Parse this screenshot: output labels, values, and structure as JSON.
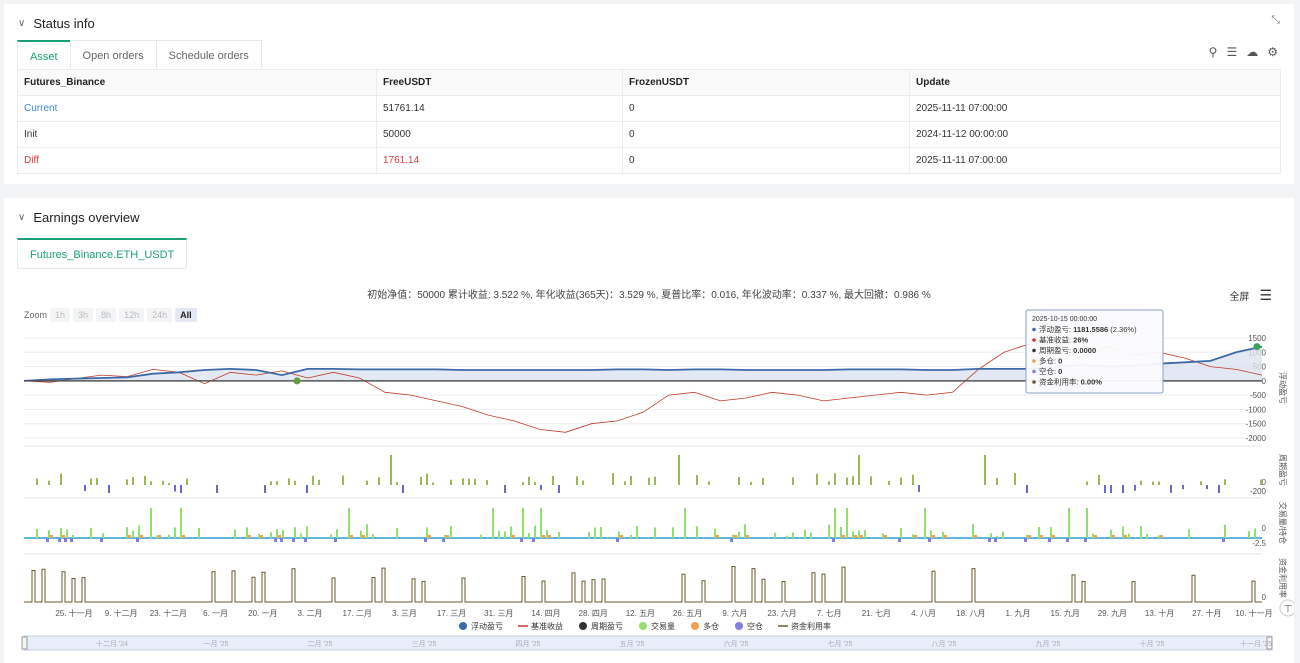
{
  "status": {
    "title": "Status info",
    "tabs": [
      "Asset",
      "Open orders",
      "Schedule orders"
    ],
    "table": {
      "headers": [
        "Futures_Binance",
        "FreeUSDT",
        "FrozenUSDT",
        "Update"
      ],
      "rows": [
        {
          "label": "Current",
          "free": "51761.14",
          "frozen": "0",
          "update": "2025-11-11 07:00:00"
        },
        {
          "label": "Init",
          "free": "50000",
          "frozen": "0",
          "update": "2024-11-12 00:00:00"
        },
        {
          "label": "Diff",
          "free": "1761.14",
          "frozen": "0",
          "update": "2025-11-11 07:00:00"
        }
      ]
    }
  },
  "earnings": {
    "title": "Earnings overview",
    "tab": "Futures_Binance.ETH_USDT",
    "summary": "初始净值：50000 累计收益: 3.522 %, 年化收益(365天)：3.529 %, 夏普比率：0.016, 年化波动率：0.337 %, 最大回撤：0.986 %",
    "fullscreen": "全屏",
    "zoom": {
      "label": "Zoom",
      "buttons": [
        "1h",
        "3h",
        "8h",
        "12h",
        "24h",
        "All"
      ],
      "active": "All"
    },
    "tooltip": {
      "date": "2025-10-15 00:00:00",
      "lines": [
        {
          "label": "浮动盈亏: ",
          "value": "1181.5586",
          "extra": " (2.36%)",
          "color": "#3c6aa8"
        },
        {
          "label": "基准收益: ",
          "value": "26%",
          "extra": "",
          "color": "#c0392b"
        },
        {
          "label": "周期盈亏: ",
          "value": "0.0000",
          "extra": "",
          "color": "#333333"
        },
        {
          "label": "多仓: ",
          "value": "0",
          "extra": "",
          "color": "#f0a050"
        },
        {
          "label": "空仓: ",
          "value": "0",
          "extra": "",
          "color": "#8080e0"
        },
        {
          "label": "资金利用率: ",
          "value": "0.00%",
          "extra": "",
          "color": "#6b5a2a"
        }
      ]
    },
    "legend": [
      {
        "label": "浮动盈亏",
        "color": "#3c6aa8",
        "kind": "dot"
      },
      {
        "label": "基准收益",
        "color": "#c0392b",
        "kind": "line"
      },
      {
        "label": "周期盈亏",
        "color": "#333333",
        "kind": "dot"
      },
      {
        "label": "交易量",
        "color": "#90e070",
        "kind": "dot"
      },
      {
        "label": "多仓",
        "color": "#f0a050",
        "kind": "dot"
      },
      {
        "label": "空仓",
        "color": "#8080e0",
        "kind": "dot"
      },
      {
        "label": "资金利用率",
        "color": "#6b5a2a",
        "kind": "line"
      }
    ],
    "axis_titles": [
      "浮动盈亏",
      "周期盈亏",
      "交易量/持仓",
      "资金利用率"
    ],
    "navigator_labels": [
      "十二月 '24",
      "一月 '25",
      "二月 '25",
      "三月 '25",
      "四月 '25",
      "五月 '25",
      "六月 '25",
      "七月 '25",
      "八月 '25",
      "九月 '25",
      "十月 '25",
      "十一月 '25"
    ]
  },
  "chart_data": {
    "type": "line",
    "x_ticks": [
      "25. 十一月",
      "9. 十二月",
      "23. 十二月",
      "6. 一月",
      "20. 一月",
      "3. 二月",
      "17. 二月",
      "3. 三月",
      "17. 三月",
      "31. 三月",
      "14. 四月",
      "28. 四月",
      "12. 五月",
      "26. 五月",
      "9. 六月",
      "23. 六月",
      "7. 七月",
      "21. 七月",
      "4. 八月",
      "18. 八月",
      "1. 九月",
      "15. 九月",
      "29. 九月",
      "13. 十月",
      "27. 十月",
      "10. 十一月"
    ],
    "y_ticks_main": [
      "1500",
      "1000",
      "500",
      "0",
      "-500",
      "-1000",
      "-1500",
      "-2000"
    ],
    "y_ticks_period": [
      "0",
      "-200"
    ],
    "y_ticks_volume": [
      "0",
      "-2.5"
    ],
    "y_ticks_util": [
      "0"
    ],
    "ylim_main": [
      -2000,
      1500
    ],
    "series": [
      {
        "name": "浮动盈亏",
        "values": [
          0,
          50,
          80,
          100,
          120,
          250,
          300,
          380,
          420,
          380,
          200,
          420,
          420,
          400,
          400,
          400,
          400,
          380,
          380,
          380,
          380,
          380,
          380,
          400,
          400,
          380,
          400,
          400,
          380,
          380,
          380,
          380,
          400,
          400,
          400,
          380,
          380,
          420,
          420,
          420,
          500,
          550,
          500,
          520,
          600,
          650,
          700,
          1000,
          1200
        ]
      },
      {
        "name": "基准收益",
        "values": [
          0,
          -50,
          80,
          200,
          150,
          400,
          300,
          -100,
          300,
          200,
          350,
          100,
          300,
          100,
          -400,
          -500,
          -700,
          -900,
          -1200,
          -1400,
          -1700,
          -1800,
          -1500,
          -1400,
          -1100,
          -500,
          -400,
          -700,
          -600,
          -400,
          -500,
          -700,
          -600,
          -500,
          -400,
          -500,
          -400,
          400,
          1000,
          1300,
          1000,
          800,
          1200,
          900,
          1000,
          800,
          500,
          400,
          200
        ]
      }
    ]
  }
}
